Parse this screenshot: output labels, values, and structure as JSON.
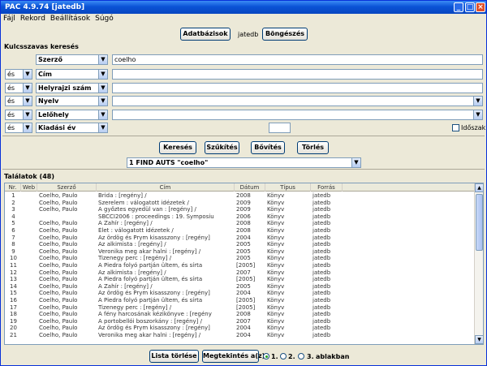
{
  "window": {
    "title": "PAC 4.9.74 [jatedb]"
  },
  "menu": [
    "Fájl",
    "Rekord",
    "Beállítások",
    "Súgó"
  ],
  "top": {
    "databases_btn": "Adatbázisok",
    "db_name": "jatedb",
    "browse_btn": "Böngészés"
  },
  "search": {
    "section_title": "Kulcsszavas keresés",
    "rows": [
      {
        "op": "",
        "field": "Szerző",
        "value": ""
      },
      {
        "op": "és",
        "field": "Cím",
        "value": ""
      },
      {
        "op": "és",
        "field": "Helyrajzi szám",
        "value": ""
      },
      {
        "op": "és",
        "field": "Nyelv",
        "value": ""
      },
      {
        "op": "és",
        "field": "Lelőhely",
        "value": ""
      },
      {
        "op": "és",
        "field": "Kiadási év",
        "value": ""
      }
    ],
    "author_value": "coelho",
    "period_label": "Időszak"
  },
  "actions": {
    "search": "Keresés",
    "narrow": "Szűkítés",
    "expand": "Bővítés",
    "delete": "Törlés"
  },
  "query": "1 FIND AUTS \"coelho\"",
  "results": {
    "title": "Találatok (48)",
    "columns": [
      "Nr.",
      "Web",
      "Szerző",
      "Cím",
      "Dátum",
      "Típus",
      "Forrás"
    ],
    "rows": [
      [
        "1",
        "",
        "Coelho, Paulo",
        "Brida : [regény] /",
        "2008",
        "Könyv",
        "jatedb"
      ],
      [
        "2",
        "",
        "Coelho, Paulo",
        "Szerelem : válogatott idézetek /",
        "2009",
        "Könyv",
        "jatedb"
      ],
      [
        "3",
        "",
        "Coelho, Paulo",
        "A győztes egyedül van : [regény] /",
        "2009",
        "Könyv",
        "jatedb"
      ],
      [
        "4",
        "",
        "",
        "SBCCI2006 : proceedings : 19. Symposiu",
        "2006",
        "Könyv",
        "jatedb"
      ],
      [
        "5",
        "",
        "Coelho, Paulo",
        "A Zahír : [regény] /",
        "2008",
        "Könyv",
        "jatedb"
      ],
      [
        "6",
        "",
        "Coelho, Paulo",
        "Élet : válogatott idézetek /",
        "2008",
        "Könyv",
        "jatedb"
      ],
      [
        "7",
        "",
        "Coelho, Paulo",
        "Az ördög és Prym kisasszony : [regény]",
        "2004",
        "Könyv",
        "jatedb"
      ],
      [
        "8",
        "",
        "Coelho, Paulo",
        "Az alkimista : [regény] /",
        "2005",
        "Könyv",
        "jatedb"
      ],
      [
        "9",
        "",
        "Coelho, Paulo",
        "Veronika meg akar halni : [regény] /",
        "2005",
        "Könyv",
        "jatedb"
      ],
      [
        "10",
        "",
        "Coelho, Paulo",
        "Tizenegy perc : [regény] /",
        "2005",
        "Könyv",
        "jatedb"
      ],
      [
        "11",
        "",
        "Coelho, Paulo",
        "A Piedra folyó partján ültem, és sírta",
        "[2005]",
        "Könyv",
        "jatedb"
      ],
      [
        "12",
        "",
        "Coelho, Paulo",
        "Az alkimista : [regény] /",
        "2007",
        "Könyv",
        "jatedb"
      ],
      [
        "13",
        "",
        "Coelho, Paulo",
        "A Piedra folyó partján ültem, és sírta",
        "[2005]",
        "Könyv",
        "jatedb"
      ],
      [
        "14",
        "",
        "Coelho, Paulo",
        "A Zahír : [regény] /",
        "2005",
        "Könyv",
        "jatedb"
      ],
      [
        "15",
        "",
        "Coelho, Paulo",
        "Az ördög és Prym kisasszony : [regény]",
        "2004",
        "Könyv",
        "jatedb"
      ],
      [
        "16",
        "",
        "Coelho, Paulo",
        "A Piedra folyó partján ültem, és sírta",
        "[2005]",
        "Könyv",
        "jatedb"
      ],
      [
        "17",
        "",
        "Coelho, Paulo",
        "Tizenegy perc : [regény] /",
        "[2005]",
        "Könyv",
        "jatedb"
      ],
      [
        "18",
        "",
        "Coelho, Paulo",
        "A fény harcosának kézikönyve : [regény",
        "2008",
        "Könyv",
        "jatedb"
      ],
      [
        "19",
        "",
        "Coelho, Paulo",
        "A portobellói boszorkány : [regény] /",
        "2007",
        "Könyv",
        "jatedb"
      ],
      [
        "20",
        "",
        "Coelho, Paulo",
        "Az ördög és Prym kisasszony : [regény]",
        "2004",
        "Könyv",
        "jatedb"
      ],
      [
        "21",
        "",
        "Coelho, Paulo",
        "Veronika meg akar halni : [regény] /",
        "2004",
        "Könyv",
        "jatedb"
      ]
    ]
  },
  "bottom": {
    "clear_list": "Lista törlése",
    "show": "Megtekintés a(z)",
    "r1": "1.",
    "r2": "2.",
    "r3": "3.",
    "window_label": "ablakban"
  },
  "colors": {
    "title_bar": "#0a53d6",
    "window_bg": "#ece9d8"
  }
}
